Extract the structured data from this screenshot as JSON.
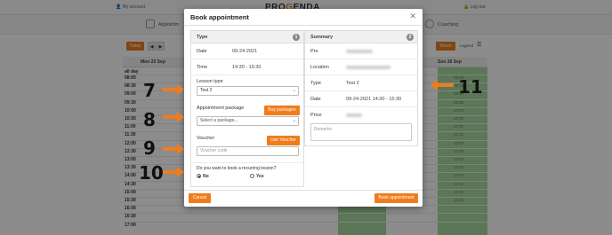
{
  "background": {
    "user_label": "My account",
    "logo_prefix": "PRO",
    "logo_mark": "G",
    "logo_suffix": "ENDA",
    "logout_label": "Log out",
    "nav_appointments": "Appointm",
    "nav_coaching": "Coaching",
    "today_button": "Today",
    "week_button": "Week",
    "legend_label": "Legend",
    "day_columns": [
      "Mon 20 Sep",
      "Sun 26 Sep"
    ],
    "all_day": "all day",
    "times": [
      "08:00",
      "08:30",
      "09:00",
      "09:30",
      "10:00",
      "10:30",
      "11:00",
      "11:30",
      "12:00",
      "12:30",
      "13:00",
      "13:30",
      "14:00",
      "14:30",
      "15:00",
      "15:30",
      "16:00",
      "16:30",
      "17:00"
    ],
    "green_slots": [
      "08:00",
      "08:30",
      "09:00",
      "09:30",
      "10:00",
      "10:30",
      "11:00",
      "11:30",
      "12:00",
      "12:30",
      "13:00",
      "13:30",
      "14:00",
      "14:30",
      "15:00",
      "15:30"
    ],
    "accent_color": "#f07c1c",
    "slot_color": "#a8d8a0"
  },
  "modal": {
    "title": "Book appointment",
    "close_icon": "close-icon",
    "type_panel": {
      "title": "Type",
      "step": "1",
      "date_label": "Date",
      "date_value": "09-24-2021",
      "time_label": "Time",
      "time_value": "14:30 - 15:30",
      "lesson_type_label": "Lesson type",
      "lesson_type_value": "Test 2",
      "package_label": "Appointment package",
      "buy_packages_button": "Buy packages",
      "package_placeholder": "Select a package...",
      "voucher_label": "Voucher",
      "use_voucher_button": "Use Voucher",
      "voucher_placeholder": "Voucher code",
      "recurring_question": "Do you want to book a recurring lesson?",
      "recurring_no": "No",
      "recurring_yes": "Yes"
    },
    "summary_panel": {
      "title": "Summary",
      "step": "2",
      "pro_label": "Pro",
      "location_label": "Location",
      "type_label": "Type",
      "type_value": "Test 2",
      "date_label": "Date",
      "date_value": "09-24-2021 14:30 - 15:30",
      "price_label": "Price",
      "remarks_placeholder": "Remarks"
    },
    "cancel_button": "Cancel",
    "book_button": "Book appointment"
  },
  "annotations": {
    "labels": [
      "7",
      "8",
      "9",
      "10",
      "11"
    ]
  }
}
